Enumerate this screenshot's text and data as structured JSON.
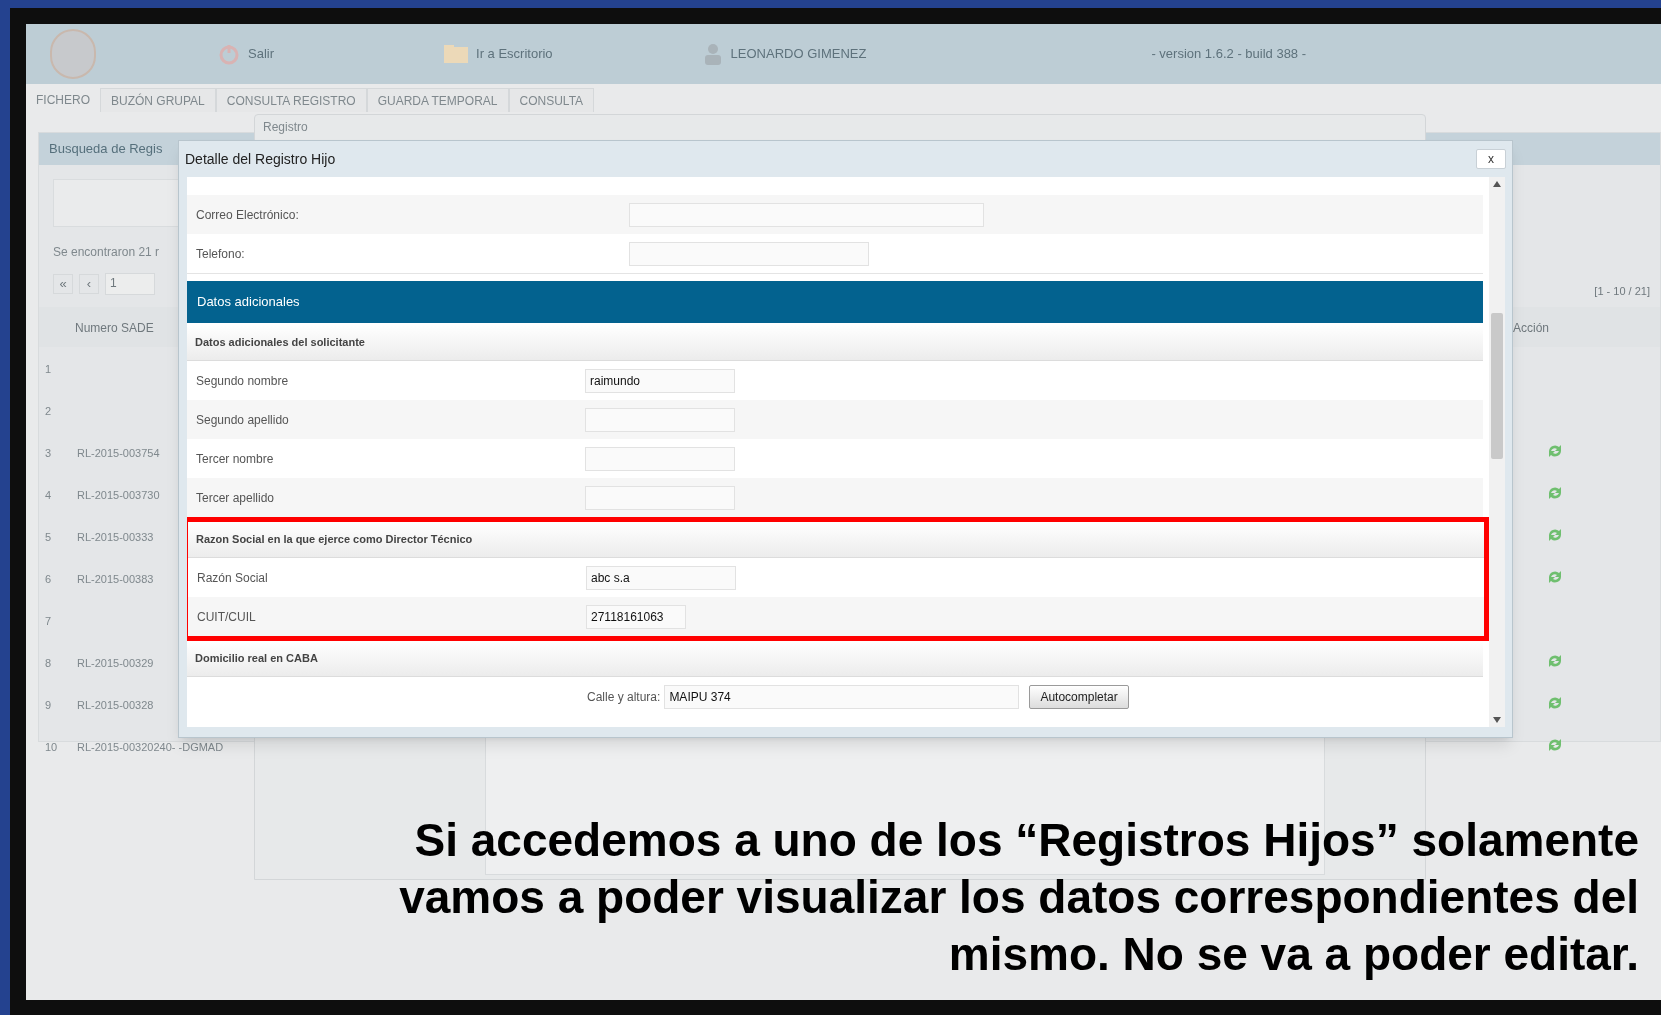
{
  "app": {
    "header": {
      "logout": "Salir",
      "desktop": "Ir a Escritorio",
      "user": "LEONARDO GIMENEZ",
      "version": "- version 1.6.2 - build 388 -"
    },
    "tabs": [
      {
        "label": "FICHERO",
        "selected": true
      },
      {
        "label": "BUZÓN GRUPAL",
        "selected": false
      },
      {
        "label": "CONSULTA REGISTRO",
        "selected": false
      },
      {
        "label": "GUARDA TEMPORAL",
        "selected": false
      },
      {
        "label": "CONSULTA",
        "selected": false
      }
    ],
    "background_window": {
      "title": "Registro"
    },
    "search_panel": {
      "title": "Busqueda de Regis",
      "found": "Se encontraron 21 r",
      "first": "«",
      "prev": "‹",
      "page": "1",
      "range": "[1 - 10 / 21]",
      "columns": [
        "Numero SADE",
        "Acción"
      ],
      "rows": [
        {
          "number": "1",
          "has_actions": false
        },
        {
          "number": "2",
          "has_actions": false
        },
        {
          "number": "3",
          "id": "RL-2015-003754",
          "has_actions": true
        },
        {
          "number": "4",
          "id": "RL-2015-003730",
          "has_actions": true
        },
        {
          "number": "5",
          "id": "RL-2015-00333",
          "has_actions": true
        },
        {
          "number": "6",
          "id": "RL-2015-00383",
          "has_actions": true
        },
        {
          "number": "7",
          "has_actions": false
        },
        {
          "number": "8",
          "id": "RL-2015-00329",
          "has_actions": true
        },
        {
          "number": "9",
          "id": "RL-2015-00328",
          "has_actions": true
        },
        {
          "number": "10",
          "id": "RL-2015-00320240- -DGMAD",
          "has_actions": true
        }
      ]
    }
  },
  "dialog": {
    "title": "Detalle del Registro Hijo",
    "close": "x",
    "sections": [
      {
        "kind": "plain",
        "rows": [
          {
            "label": "Correo Electrónico:"
          },
          {
            "label": "Telefono:"
          }
        ]
      },
      {
        "kind": "banner",
        "title": "Datos adicionales"
      },
      {
        "kind": "group",
        "title": "Datos adicionales del solicitante",
        "highlighted": false,
        "rows": [
          {
            "label": "Segundo nombre",
            "value": "raimundo"
          },
          {
            "label": "Segundo apellido"
          },
          {
            "label": "Tercer nombre"
          },
          {
            "label": "Tercer apellido"
          }
        ]
      },
      {
        "kind": "group",
        "title": "Razon Social en la que ejerce como Director Técnico",
        "highlighted": true,
        "rows": [
          {
            "label": "Razón Social",
            "value": "abc s.a"
          },
          {
            "label": "CUIT/CUIL",
            "value": "27118161063"
          }
        ]
      },
      {
        "kind": "group",
        "title": "Domicilio real en CABA",
        "highlighted": false,
        "rows": [
          {
            "kind": "address",
            "label": "Calle y altura:",
            "value": "MAIPU 374",
            "button": "Autocompletar"
          }
        ]
      }
    ]
  },
  "slide_caption": "Si accedemos a uno de los “Registros Hijos” solamente vamos a poder visualizar los datos correspondientes del mismo. No se va a poder editar."
}
